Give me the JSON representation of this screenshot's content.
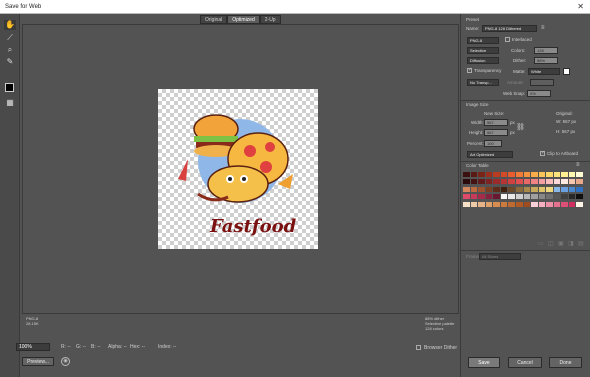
{
  "window": {
    "title": "Save for Web"
  },
  "tools": [
    "hand-icon",
    "slice-select-icon",
    "zoom-icon",
    "eyedropper-icon",
    "slice-toggle-icon"
  ],
  "tabs": [
    "Original",
    "Optimized",
    "2-Up"
  ],
  "artwork": {
    "text": "Fastfood"
  },
  "info_left": [
    "PNG-8",
    "28.15K"
  ],
  "info_right": [
    "88% dither",
    "Selective palette",
    "128 colors"
  ],
  "bottom": {
    "zoom": "100%",
    "r": "R: --",
    "g": "G: --",
    "b": "B: --",
    "alpha": "Alpha: --",
    "hex": "Hex: --",
    "index": "Index: --",
    "browser_dither": "Browser Dither",
    "preview": "Preview..."
  },
  "preset": {
    "header": "Preset",
    "name_label": "Name:",
    "name_value": "PNG-8 128 Dithered",
    "format": "PNG-8",
    "interlaced": "Interlaced",
    "reduction": "Selective",
    "colors_label": "Colors:",
    "colors_value": "128",
    "dither_algo": "Diffusion",
    "dither_label": "Dither:",
    "dither_value": "88%",
    "transparency": "Transparency",
    "matte_label": "Matte:",
    "matte_value": "White",
    "transp_dither": "No Transp...",
    "amount_label": "Amount:",
    "websnap_label": "Web Snap:",
    "websnap_value": "0%"
  },
  "image_size": {
    "header": "Image Size",
    "new_size": "New Size:",
    "original": "Original:",
    "w_label": "Width:",
    "w_value": "567",
    "h_label": "Height:",
    "h_value": "567",
    "unit": "px",
    "orig_w": "W: 567 px",
    "orig_h": "H: 567 px",
    "percent_label": "Percent:",
    "percent_value": "100",
    "quality": "Art Optimized",
    "clip": "Clip to Artboard"
  },
  "color_table": {
    "header": "Color Table",
    "swatches": [
      "#3a1010",
      "#5a1a14",
      "#7a2418",
      "#9c2e1e",
      "#b83b22",
      "#d44a28",
      "#e85c2e",
      "#f07a36",
      "#f5943e",
      "#f8ad48",
      "#fbc456",
      "#fdd868",
      "#fee47a",
      "#fff091",
      "#fff6b0",
      "#fffbd4",
      "#2a0a0a",
      "#471212",
      "#631a1a",
      "#7f2222",
      "#9b2a2a",
      "#b73434",
      "#cf4040",
      "#e05050",
      "#ea6868",
      "#f08484",
      "#f5a0a0",
      "#f9bdbd",
      "#fcd8d8",
      "#ffe8e0",
      "#f4c8b0",
      "#e8a88a",
      "#d8885e",
      "#c06a40",
      "#a0522e",
      "#7e3e22",
      "#5e2c18",
      "#40200e",
      "#6a4a2a",
      "#8a6a3a",
      "#aa8a4a",
      "#c8aa5a",
      "#e0c46a",
      "#f0d880",
      "#8ab8e8",
      "#6aa0e0",
      "#4a88d0",
      "#3070c0",
      "#e04a6a",
      "#c83a5a",
      "#a82a4a",
      "#882040",
      "#681830",
      "#f8f8f8",
      "#e8e8e8",
      "#d0d0d0",
      "#b8b8b8",
      "#a0a0a0",
      "#888888",
      "#707070",
      "#585858",
      "#404040",
      "#282828",
      "#101010",
      "#f6e0c8",
      "#eecaa8",
      "#e6b488",
      "#dea06a",
      "#d88c50",
      "#cc7a3e",
      "#bf6a30",
      "#b05a26",
      "#a04c1e",
      "#f9d0d8",
      "#f4b0c0",
      "#ec90a8",
      "#e47090",
      "#dc5078",
      "#d03060",
      "#fff6e8"
    ]
  },
  "animation": {
    "label": "Frames:",
    "value": "All Slices"
  },
  "buttons": {
    "save": "Save",
    "cancel": "Cancel",
    "done": "Done"
  }
}
